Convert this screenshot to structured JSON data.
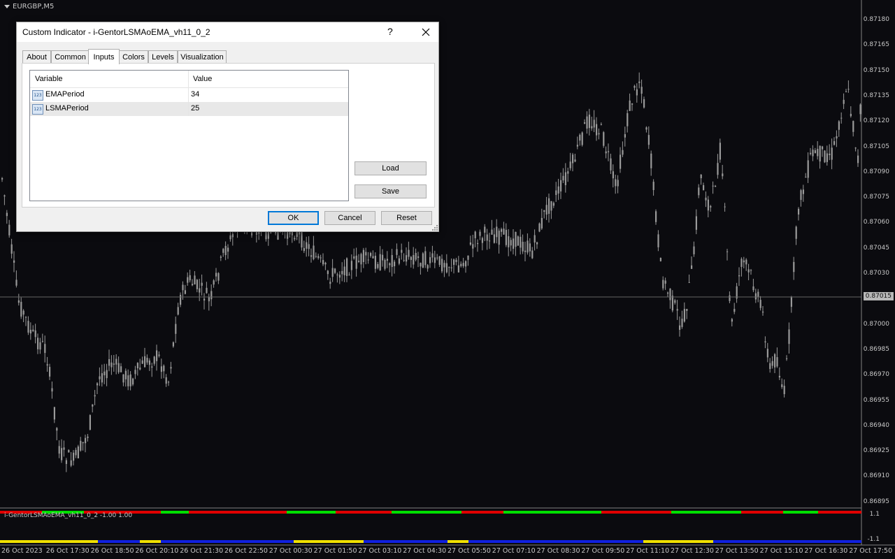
{
  "chart": {
    "symbol": "EURGBP,M5",
    "price_levels": [
      "0.87180",
      "0.87165",
      "0.87150",
      "0.87135",
      "0.87120",
      "0.87105",
      "0.87090",
      "0.87075",
      "0.87060",
      "0.87045",
      "0.87030",
      "0.87015",
      "0.87000",
      "0.86985",
      "0.86970",
      "0.86955",
      "0.86940",
      "0.86925",
      "0.86910",
      "0.86895"
    ],
    "current_price": "0.87015",
    "time_labels": [
      "26 Oct 2023",
      "26 Oct 17:30",
      "26 Oct 18:50",
      "26 Oct 20:10",
      "26 Oct 21:30",
      "26 Oct 22:50",
      "27 Oct 00:30",
      "27 Oct 01:50",
      "27 Oct 03:10",
      "27 Oct 04:30",
      "27 Oct 05:50",
      "27 Oct 07:10",
      "27 Oct 08:30",
      "27 Oct 09:50",
      "27 Oct 11:10",
      "27 Oct 12:30",
      "27 Oct 13:50",
      "27 Oct 15:10",
      "27 Oct 16:30",
      "27 Oct 17:50"
    ],
    "colors": {
      "background": "#0b0b0f",
      "candle": "#9a9a9a",
      "indicator_up": "#00e000",
      "indicator_down": "#e00000",
      "indicator_yellow": "#f0e000",
      "indicator_blue": "#1020e0"
    }
  },
  "indicator": {
    "label": "i-GentorLSMAoEMA_vh11_0_2 -1.00 1.00",
    "scale_top": "1.1",
    "scale_bottom": "-1.1"
  },
  "dialog": {
    "title": "Custom Indicator - i-GentorLSMAoEMA_vh11_0_2",
    "help": "?",
    "tabs": [
      "About",
      "Common",
      "Inputs",
      "Colors",
      "Levels",
      "Visualization"
    ],
    "active_tab": "Inputs",
    "columns": {
      "variable": "Variable",
      "value": "Value"
    },
    "rows": [
      {
        "icon": "123",
        "variable": "EMAPeriod",
        "value": "34"
      },
      {
        "icon": "123",
        "variable": "LSMAPeriod",
        "value": "25"
      }
    ],
    "buttons": {
      "load": "Load",
      "save": "Save",
      "ok": "OK",
      "cancel": "Cancel",
      "reset": "Reset"
    }
  }
}
